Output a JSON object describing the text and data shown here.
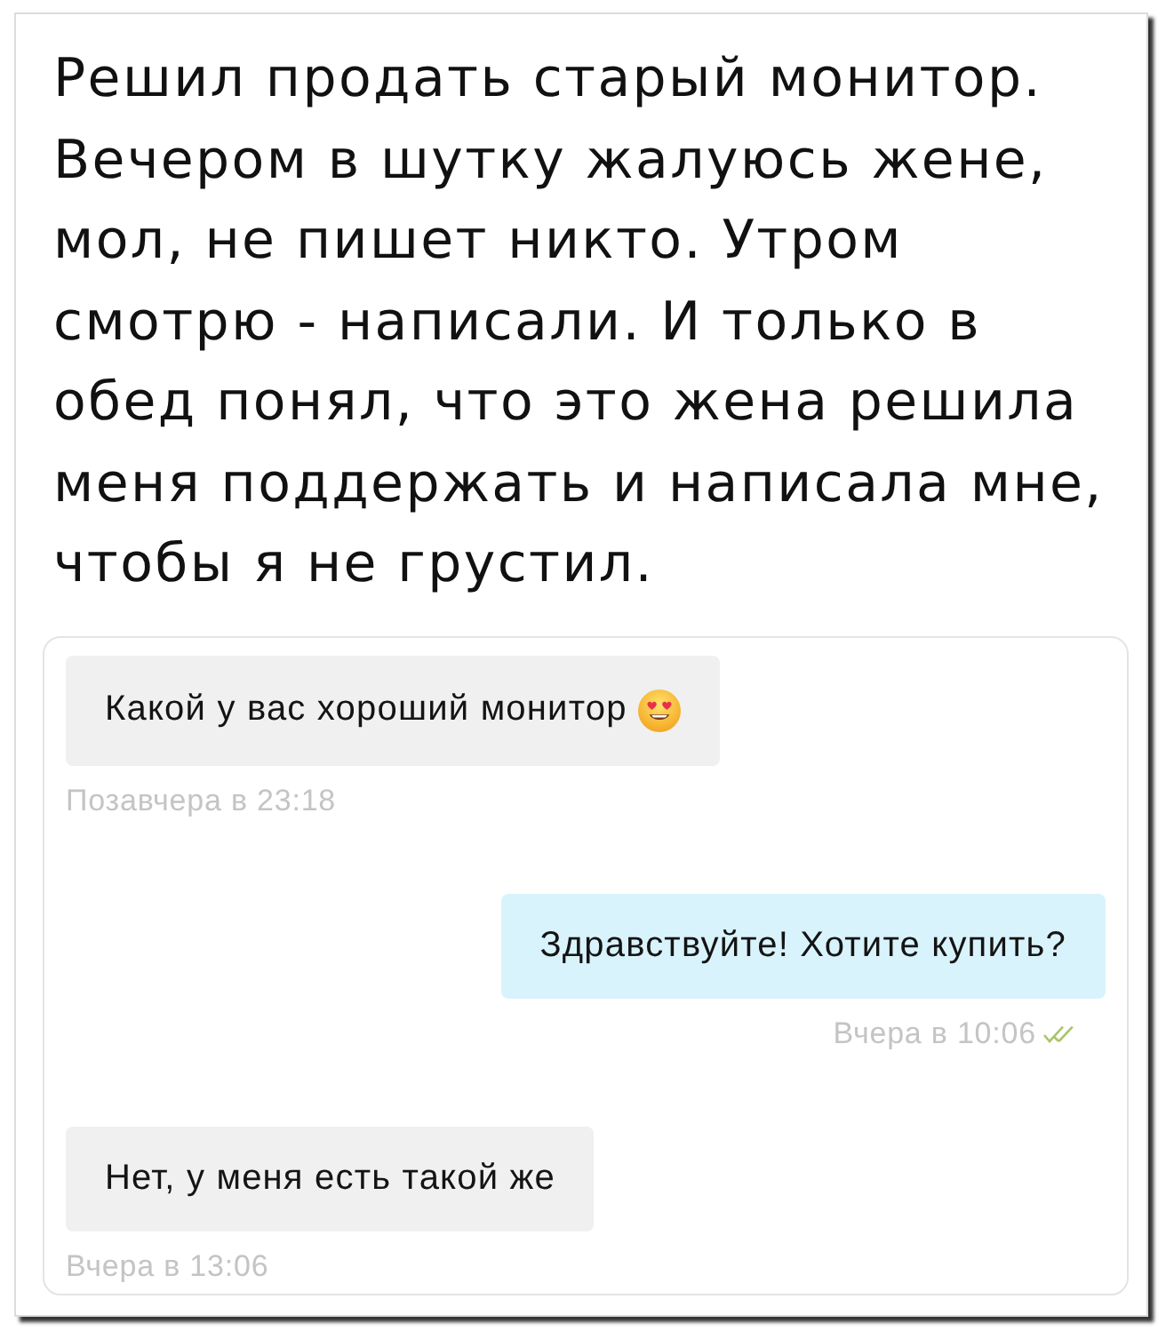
{
  "post": {
    "text": "Решил продать старый монитор. Вечером в шутку жалуюсь жене, мол, не пишет никто. Утром смотрю - написали. И только в обед понял, что это жена решила меня поддержать и написала мне, чтобы я не грустил."
  },
  "chat": {
    "messages": [
      {
        "kind": "incoming",
        "text": "Какой у вас хороший монитор",
        "emoji": true,
        "time": "Позавчера в 23:18",
        "read": false
      },
      {
        "kind": "outgoing",
        "text": "Здравствуйте! Хотите купить?",
        "emoji": false,
        "time": "Вчера в 10:06",
        "read": true
      },
      {
        "kind": "incoming",
        "text": "Нет, у меня есть такой же",
        "emoji": false,
        "time": "Вчера в 13:06",
        "read": false
      }
    ]
  }
}
